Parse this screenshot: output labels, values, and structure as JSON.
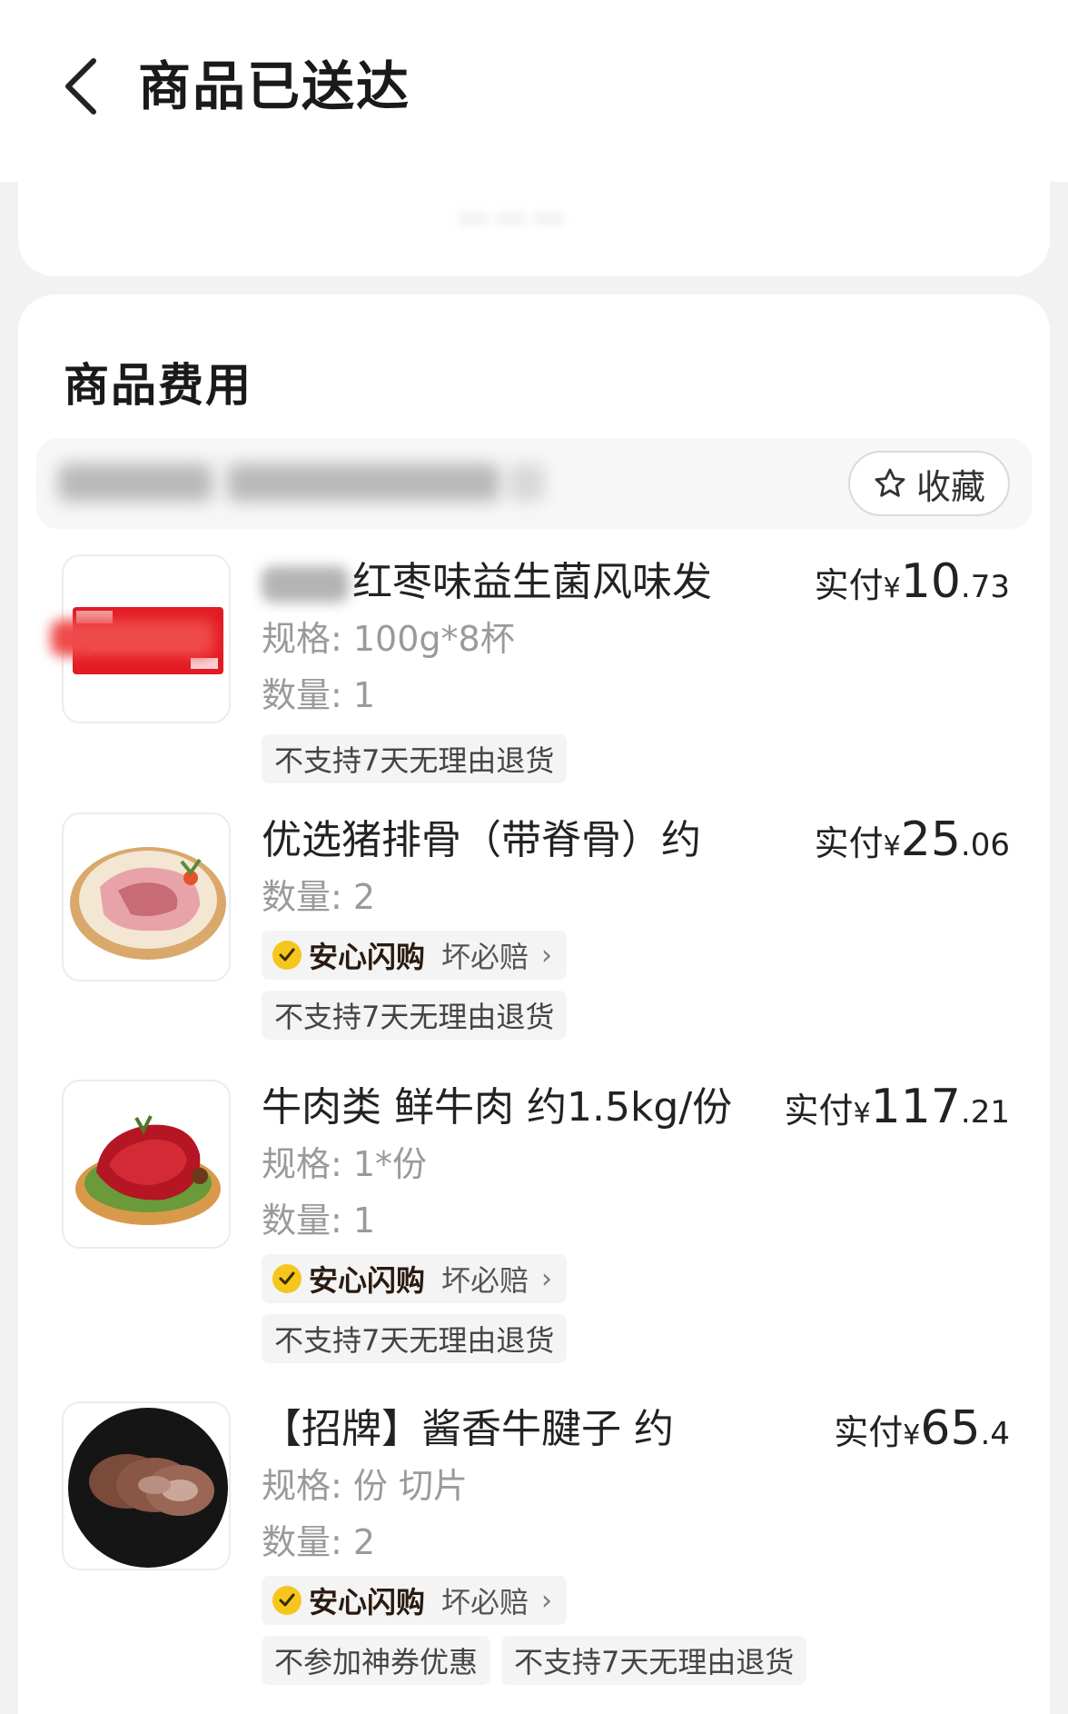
{
  "header": {
    "title": "商品已送达",
    "back_icon": "chevron-left-icon"
  },
  "fees": {
    "section_title": "商品费用",
    "favorite_label": "收藏",
    "favorite_icon": "star-outline-icon"
  },
  "products": [
    {
      "name": "红枣味益生菌风味发",
      "spec": "规格: 100g*8杯",
      "qty": "数量: 1",
      "price_label": "实付",
      "currency": "¥",
      "price_int": "10",
      "price_dec": ".73",
      "guarantee": null,
      "tags": [
        "不支持7天无理由退货"
      ],
      "thumb_icon": "yogurt-box-image"
    },
    {
      "name": "优选猪排骨（带脊骨）约",
      "spec": null,
      "qty": "数量: 2",
      "price_label": "实付",
      "currency": "¥",
      "price_int": "25",
      "price_dec": ".06",
      "guarantee": {
        "title": "安心闪购",
        "sub": "坏必赔",
        "arrow": "›"
      },
      "tags": [
        "不支持7天无理由退货"
      ],
      "thumb_icon": "pork-ribs-image"
    },
    {
      "name": "牛肉类 鲜牛肉 约1.5kg/份",
      "spec": "规格: 1*份",
      "qty": "数量: 1",
      "price_label": "实付",
      "currency": "¥",
      "price_int": "117",
      "price_dec": ".21",
      "guarantee": {
        "title": "安心闪购",
        "sub": "坏必赔",
        "arrow": "›"
      },
      "tags": [
        "不支持7天无理由退货"
      ],
      "thumb_icon": "fresh-beef-image"
    },
    {
      "name": "【招牌】酱香牛腱子 约",
      "spec": "规格: 份 切片",
      "qty": "数量: 2",
      "price_label": "实付",
      "currency": "¥",
      "price_int": "65",
      "price_dec": ".4",
      "guarantee": {
        "title": "安心闪购",
        "sub": "坏必赔",
        "arrow": "›"
      },
      "tags": [
        "不参加神券优惠",
        "不支持7天无理由退货"
      ],
      "thumb_icon": "braised-beef-shank-image"
    }
  ],
  "colors": {
    "background": "#f2f2f2",
    "card": "#ffffff",
    "tag_bg": "#f4f4f4",
    "muted_text": "#9a9a9a",
    "guarantee_gold": "#f6c61c",
    "yogurt_red": "#e31b23"
  }
}
